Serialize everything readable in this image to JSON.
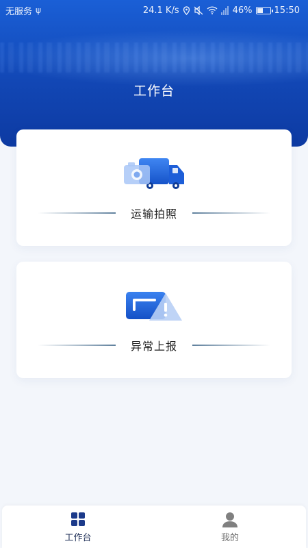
{
  "status_bar": {
    "carrier": "无服务",
    "network_speed": "24.1 K/s",
    "battery": "46%",
    "battery_level": 0.46,
    "time": "15:50"
  },
  "header": {
    "title": "工作台"
  },
  "cards": [
    {
      "label": "运输拍照",
      "icon": "truck-camera-icon"
    },
    {
      "label": "异常上报",
      "icon": "warning-card-icon"
    }
  ],
  "bottom_nav": {
    "items": [
      {
        "label": "工作台",
        "icon": "grid-icon",
        "active": true
      },
      {
        "label": "我的",
        "icon": "user-icon",
        "active": false
      }
    ]
  },
  "colors": {
    "header_blue": "#1247b5",
    "accent": "#1a5fd6",
    "nav_active": "#1c3a8a",
    "nav_inactive": "#808080"
  }
}
